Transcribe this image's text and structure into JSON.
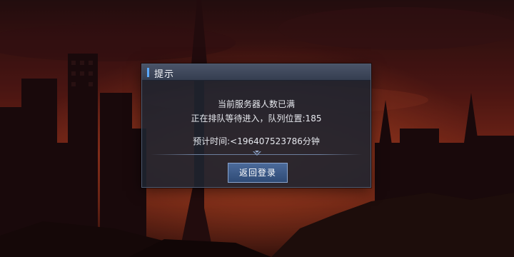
{
  "dialog": {
    "title": "提示",
    "message_line1": "当前服务器人数已满",
    "message_line2": "正在排队等待进入，队列位置:185",
    "message_line3": "预计时间:<196407523786分钟",
    "back_button_label": "返回登录"
  },
  "queue": {
    "position": 185,
    "estimated_minutes": "<196407523786"
  },
  "colors": {
    "sky_top": "#3a1414",
    "sky_glow": "#b03a24",
    "dialog_bg": "#1e2430",
    "title_accent": "#5aa8ff",
    "button_bg": "#3b5a88"
  },
  "icons": {
    "divider_ornament": "chevron-down-icon"
  }
}
